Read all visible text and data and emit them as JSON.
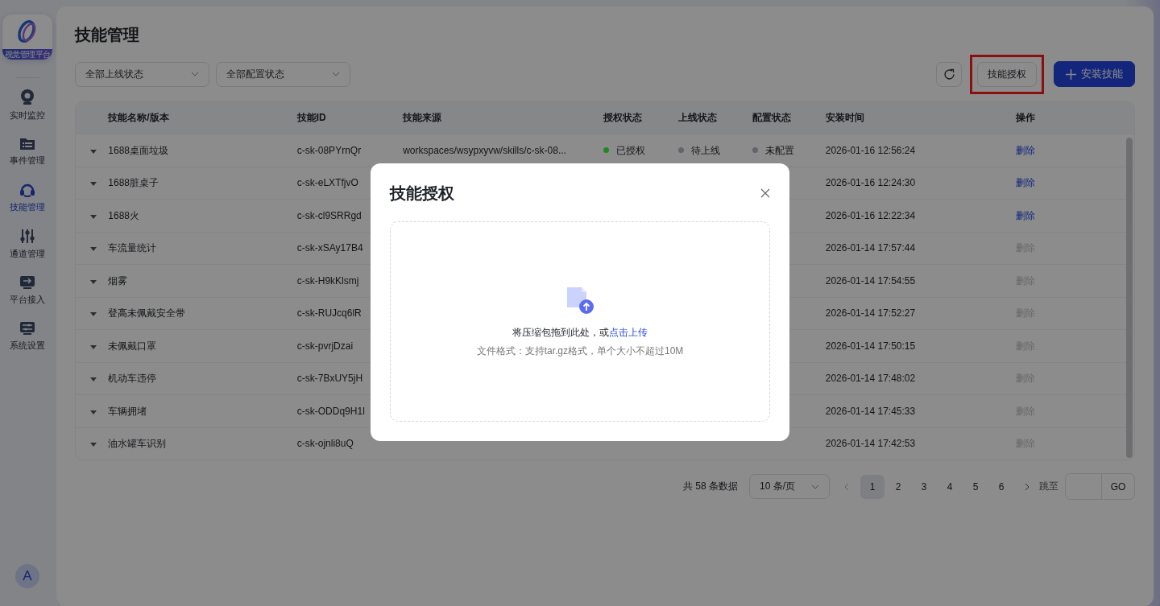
{
  "sidebar": {
    "logo_caption": "视觉管理平台",
    "items": [
      {
        "label": "实时监控",
        "selected": false
      },
      {
        "label": "事件管理",
        "selected": false
      },
      {
        "label": "技能管理",
        "selected": true
      },
      {
        "label": "通道管理",
        "selected": false
      },
      {
        "label": "平台接入",
        "selected": false
      },
      {
        "label": "系统设置",
        "selected": false
      }
    ],
    "avatar": "A"
  },
  "page": {
    "title": "技能管理",
    "filters": [
      {
        "value": "全部上线状态"
      },
      {
        "value": "全部配置状态"
      }
    ],
    "actions": [
      {
        "kind": "refresh"
      },
      {
        "kind": "secondary",
        "label": "技能授权",
        "highlighted": true
      },
      {
        "kind": "primary",
        "label": "安装技能"
      }
    ]
  },
  "table": {
    "columns": [
      "技能名称/版本",
      "技能ID",
      "技能来源",
      "授权状态",
      "上线状态",
      "配置状态",
      "安装时间",
      "操作"
    ],
    "rows": [
      {
        "name": "1688桌面垃圾",
        "id": "c-sk-08PYrnQr",
        "source": "workspaces/wsypxyvw/skills/c-sk-08...",
        "auth": {
          "label": "已授权",
          "color": "#1f8a1f"
        },
        "online": {
          "label": "待上线",
          "color": "#60646c"
        },
        "config": {
          "label": "未配置",
          "color": "#60646c"
        },
        "time": "2026-01-16 12:56:24",
        "action": {
          "label": "删除",
          "disabled": false
        }
      },
      {
        "name": "1688脏桌子",
        "id": "c-sk-eLXTfjvO",
        "time": "2026-01-16 12:24:30",
        "action": {
          "label": "删除",
          "disabled": false
        }
      },
      {
        "name": "1688火",
        "id": "c-sk-cl9SRRgd",
        "time": "2026-01-16 12:22:34",
        "action": {
          "label": "删除",
          "disabled": false
        }
      },
      {
        "name": "车流量统计",
        "id": "c-sk-xSAy17B4",
        "time": "2026-01-14 17:57:44",
        "action": {
          "label": "删除",
          "disabled": true
        }
      },
      {
        "name": "烟雾",
        "id": "c-sk-H9kKlsmj",
        "time": "2026-01-14 17:54:55",
        "action": {
          "label": "删除",
          "disabled": true
        }
      },
      {
        "name": "登高未佩戴安全带",
        "id": "c-sk-RUJcq6lR",
        "time": "2026-01-14 17:52:27",
        "action": {
          "label": "删除",
          "disabled": true
        }
      },
      {
        "name": "未佩戴口罩",
        "id": "c-sk-pvrjDzai",
        "time": "2026-01-14 17:50:15",
        "action": {
          "label": "删除",
          "disabled": true
        }
      },
      {
        "name": "机动车违停",
        "id": "c-sk-7BxUY5jH",
        "time": "2026-01-14 17:48:02",
        "action": {
          "label": "删除",
          "disabled": true
        }
      },
      {
        "name": "车辆拥堵",
        "id": "c-sk-ODDq9H1l",
        "time": "2026-01-14 17:45:33",
        "action": {
          "label": "删除",
          "disabled": true
        }
      },
      {
        "name": "油水罐车识别",
        "id": "c-sk-ojnli8uQ",
        "time": "2026-01-14 17:42:53",
        "action": {
          "label": "删除",
          "disabled": true
        }
      }
    ]
  },
  "pagination": {
    "total": "共 58 条数据",
    "page_size": "10 条/页",
    "pages": [
      {
        "label": "1",
        "selected": true
      },
      {
        "label": "2",
        "selected": false
      },
      {
        "label": "3",
        "selected": false
      },
      {
        "label": "4",
        "selected": false
      },
      {
        "label": "5",
        "selected": false
      },
      {
        "label": "6",
        "selected": false
      }
    ],
    "jump_label": "跳至",
    "go": "GO"
  },
  "modal": {
    "title": "技能授权",
    "drop_text": "将压缩包拖到此处，或",
    "upload_link": "点击上传",
    "hint": "文件格式：支持tar.gz格式，单个大小不超过10M"
  }
}
